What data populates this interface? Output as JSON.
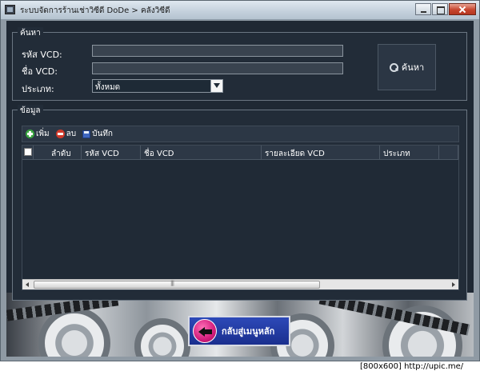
{
  "window": {
    "title": "ระบบจัดการร้านเช่าวิซีดี DoDe > คลังวิซีดี"
  },
  "search_panel": {
    "legend": "ค้นหา",
    "code_label": "รหัส VCD:",
    "code_value": "",
    "name_label": "ชื่อ VCD:",
    "name_value": "",
    "type_label": "ประเภท:",
    "type_selected": "ทั้งหมด",
    "search_button": "ค้นหา"
  },
  "data_panel": {
    "legend": "ข้อมูล",
    "toolbar": {
      "add": "เพิ่ม",
      "delete": "ลบ",
      "save": "บันทึก"
    },
    "columns": [
      "ลำดับ",
      "รหัส VCD",
      "ชื่อ VCD",
      "รายละเอียด VCD",
      "ประเภท",
      ""
    ]
  },
  "footer": {
    "back_button": "กลับสู่เมนูหลัก"
  },
  "watermark": "[800x600] http://upic.me/"
}
